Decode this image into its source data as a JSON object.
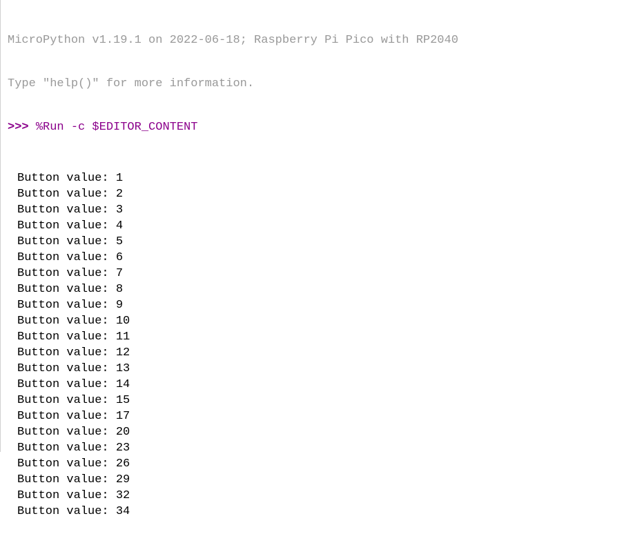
{
  "header": {
    "line1": "MicroPython v1.19.1 on 2022-06-18; Raspberry Pi Pico with RP2040",
    "line2": "Type \"help()\" for more information."
  },
  "prompt": {
    "symbol": ">>> ",
    "command": "%Run -c $EDITOR_CONTENT"
  },
  "output": {
    "label": "Button value:",
    "values": [
      "1",
      "2",
      "3",
      "4",
      "5",
      "6",
      "7",
      "8",
      "9",
      "10",
      "11",
      "12",
      "13",
      "14",
      "15",
      "17",
      "20",
      "23",
      "26",
      "29",
      "32",
      "34"
    ]
  }
}
